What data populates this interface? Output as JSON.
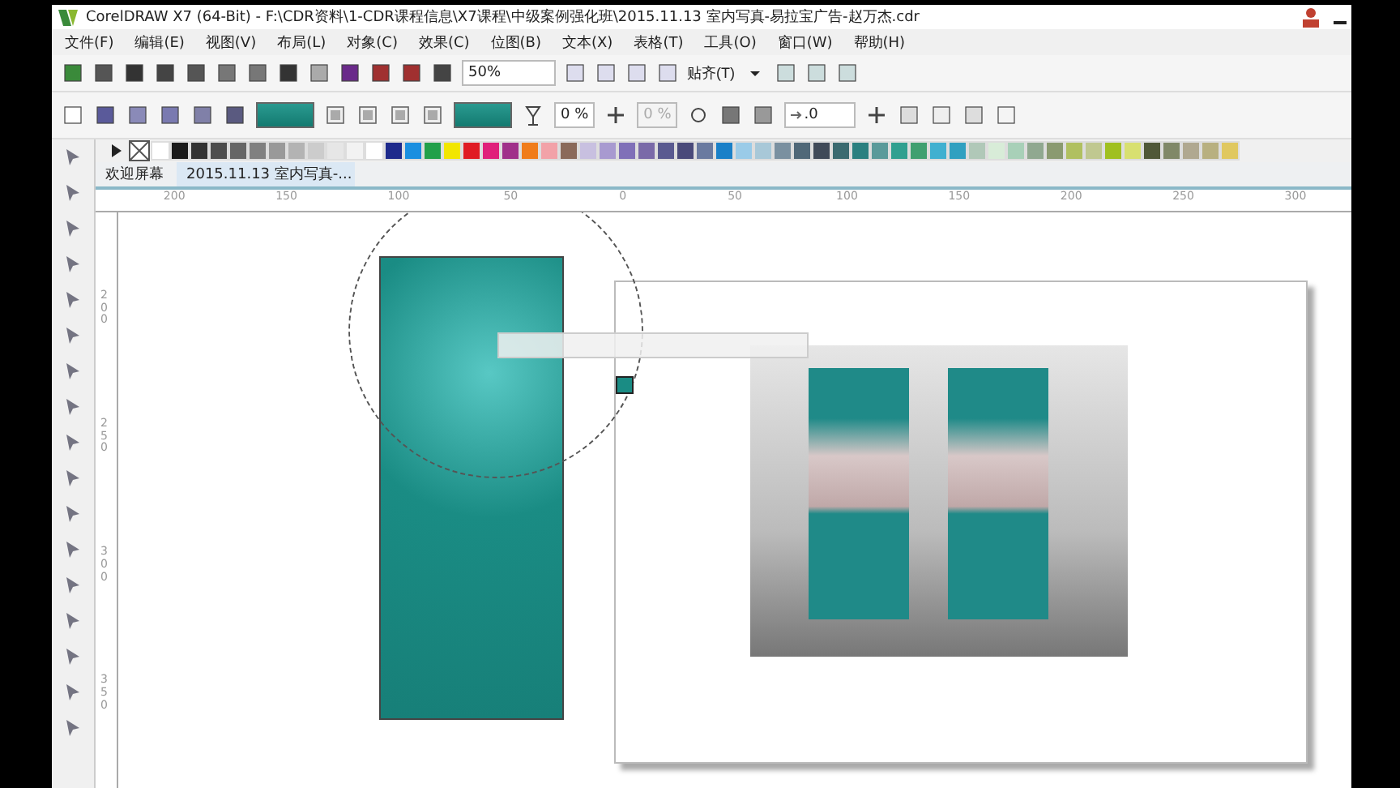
{
  "window": {
    "title": "CorelDRAW X7 (64-Bit) - F:\\CDR资料\\1-CDR课程信息\\X7课程\\中级案例强化班\\2015.11.13 室内写真-易拉宝广告-赵万杰.cdr"
  },
  "menu": [
    "文件(F)",
    "编辑(E)",
    "视图(V)",
    "布局(L)",
    "对象(C)",
    "效果(C)",
    "位图(B)",
    "文本(X)",
    "表格(T)",
    "工具(O)",
    "窗口(W)",
    "帮助(H)"
  ],
  "toolbar": {
    "zoom": "50%",
    "snap": "贴齐(T)"
  },
  "property_bar": {
    "transparency": "0 %",
    "second_value": "0 %",
    "second_disabled": true,
    "offset": ".0"
  },
  "palette": [
    {
      "color": "#ffffff"
    },
    {
      "color": "#1a1a1a"
    },
    {
      "color": "#333333"
    },
    {
      "color": "#4d4d4d"
    },
    {
      "color": "#666666"
    },
    {
      "color": "#808080"
    },
    {
      "color": "#999999"
    },
    {
      "color": "#b3b3b3"
    },
    {
      "color": "#cccccc"
    },
    {
      "color": "#e6e6e6"
    },
    {
      "color": "#f2f2f2"
    },
    {
      "color": "#ffffff"
    },
    {
      "color": "#1e2a8c"
    },
    {
      "color": "#1a8fe0"
    },
    {
      "color": "#22a04a"
    },
    {
      "color": "#f2e600"
    },
    {
      "color": "#e01b24"
    },
    {
      "color": "#e0207a"
    },
    {
      "color": "#a0308a"
    },
    {
      "color": "#f07c1a"
    },
    {
      "color": "#f2a2a8"
    },
    {
      "color": "#8a6a5a"
    },
    {
      "color": "#c8c0e0"
    },
    {
      "color": "#a89ad0"
    },
    {
      "color": "#8070b8"
    },
    {
      "color": "#7a6aa8"
    },
    {
      "color": "#5a5a90"
    },
    {
      "color": "#4a4a7a"
    },
    {
      "color": "#6a7aa0"
    },
    {
      "color": "#1a80c8"
    },
    {
      "color": "#9acbe8"
    },
    {
      "color": "#a8c8d8"
    },
    {
      "color": "#7a90a0"
    },
    {
      "color": "#506878"
    },
    {
      "color": "#404a58"
    },
    {
      "color": "#3a6a70"
    },
    {
      "color": "#2a8080"
    },
    {
      "color": "#5a9a9a"
    },
    {
      "color": "#30a090"
    },
    {
      "color": "#40a070"
    },
    {
      "color": "#40b0d0"
    },
    {
      "color": "#30a0c0"
    },
    {
      "color": "#b0c8b8"
    },
    {
      "color": "#d8ecd8"
    },
    {
      "color": "#a8d0b8"
    },
    {
      "color": "#90a890"
    },
    {
      "color": "#8a9a70"
    },
    {
      "color": "#b0c060"
    },
    {
      "color": "#c0c890"
    },
    {
      "color": "#a0c020"
    },
    {
      "color": "#d8e070"
    },
    {
      "color": "#505838"
    },
    {
      "color": "#808868"
    },
    {
      "color": "#b0a890"
    },
    {
      "color": "#b8b080"
    },
    {
      "color": "#e0c860"
    }
  ],
  "tabs": [
    {
      "label": "欢迎屏幕",
      "selected": false
    },
    {
      "label": "2015.11.13 室内写真-...",
      "selected": true
    }
  ],
  "ruler": {
    "horizontal": [
      "200",
      "150",
      "100",
      "50",
      "0",
      "50",
      "100",
      "150",
      "200",
      "250",
      "300"
    ],
    "vertical": [
      "200",
      "250",
      "300",
      "350"
    ]
  }
}
